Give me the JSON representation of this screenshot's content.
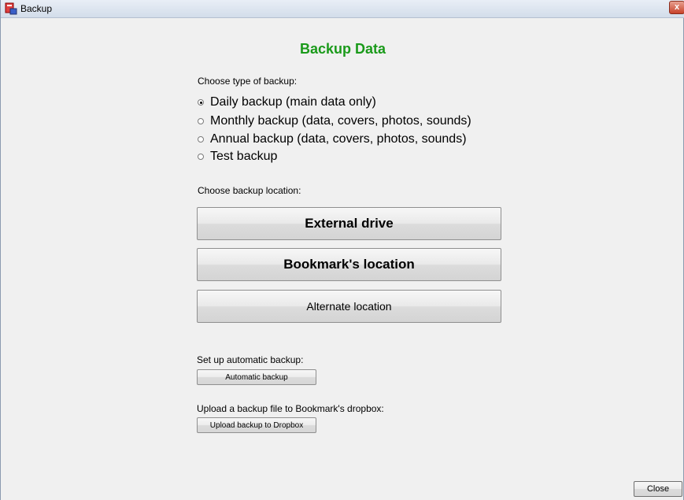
{
  "window": {
    "title": "Backup",
    "close_glyph": "x"
  },
  "heading": "Backup Data",
  "backup_type": {
    "label": "Choose type of backup:",
    "options": [
      {
        "label": "Daily backup (main data only)",
        "checked": true
      },
      {
        "label": "Monthly backup (data, covers, photos, sounds)",
        "checked": false
      },
      {
        "label": "Annual backup (data, covers, photos, sounds)",
        "checked": false
      },
      {
        "label": "Test backup",
        "checked": false
      }
    ]
  },
  "location": {
    "label": "Choose backup location:",
    "external_drive": "External drive",
    "bookmarks_location": "Bookmark's location",
    "alternate_location": "Alternate location"
  },
  "automatic": {
    "label": "Set up automatic backup:",
    "button": "Automatic backup"
  },
  "upload": {
    "label": "Upload a backup file to Bookmark's dropbox:",
    "button": "Upload backup to Dropbox"
  },
  "footer": {
    "close": "Close"
  },
  "colors": {
    "heading": "#1a9a1a",
    "close_button": "#c8422a"
  }
}
